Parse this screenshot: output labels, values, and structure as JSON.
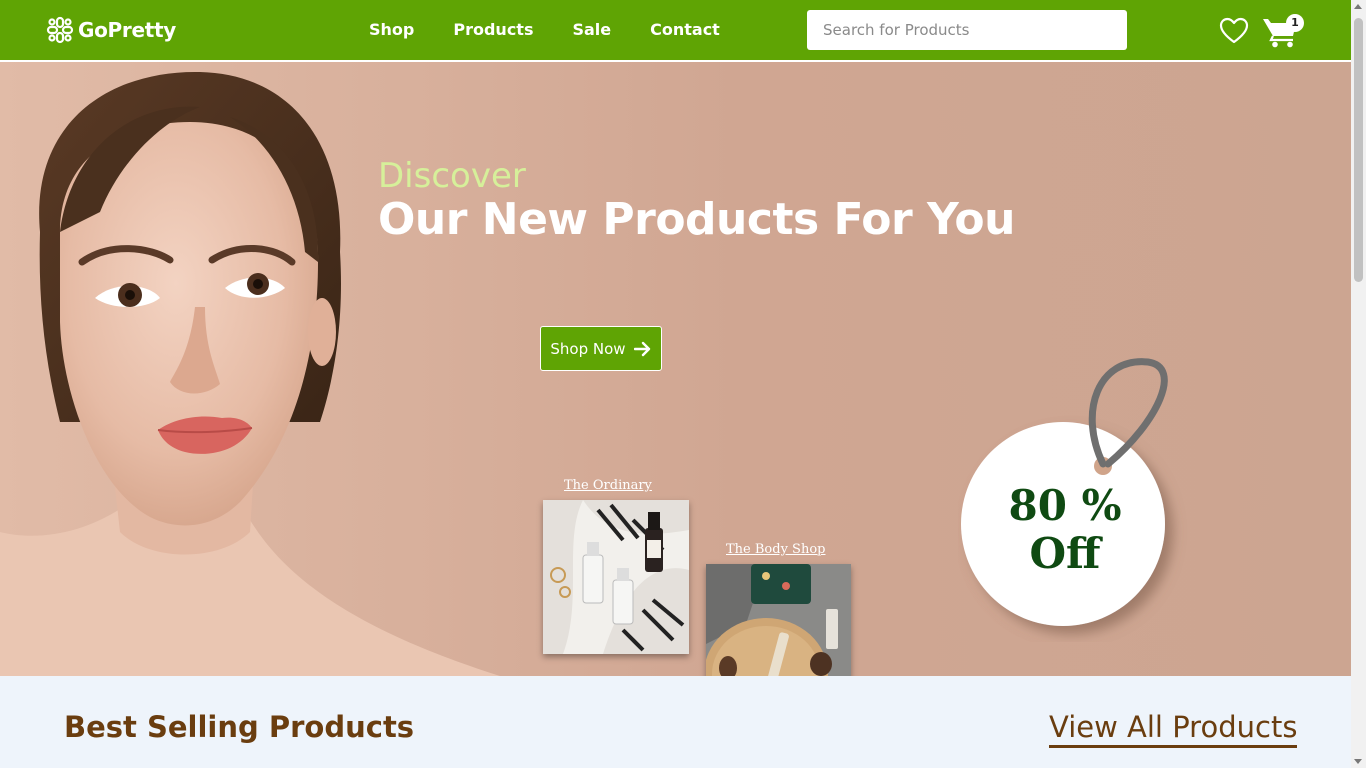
{
  "header": {
    "brand": "GoPretty",
    "nav": [
      "Shop",
      "Products",
      "Sale",
      "Contact"
    ],
    "search_placeholder": "Search for Products",
    "cart_count": "1",
    "accent_color": "#5fa404"
  },
  "hero": {
    "eyebrow": "Discover",
    "title": "Our New Products For You",
    "cta": "Shop Now",
    "brands": [
      {
        "label": "The Ordinary"
      },
      {
        "label": "The Body Shop"
      }
    ],
    "tag_line1": "80 %",
    "tag_line2": "Off"
  },
  "best_selling": {
    "title": "Best Selling Products",
    "view_all": "View All Products",
    "text_color": "#6a3d0f"
  },
  "icons": [
    "logo-icon",
    "heart-icon",
    "cart-icon",
    "arrow-right-icon"
  ]
}
